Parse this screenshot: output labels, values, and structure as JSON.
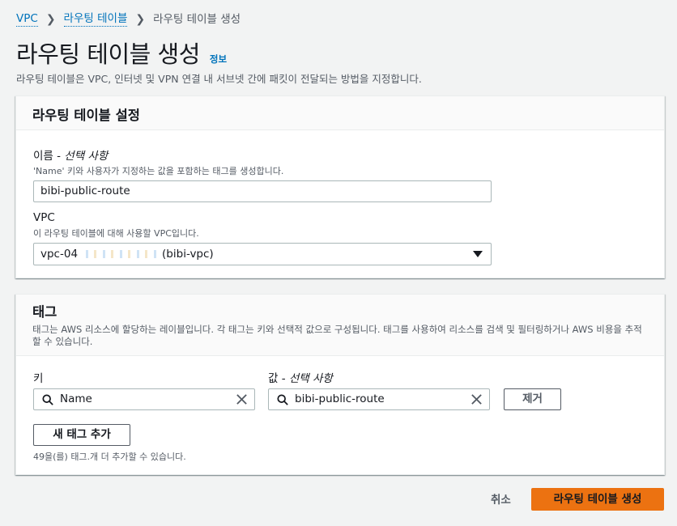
{
  "breadcrumb": {
    "items": [
      "VPC",
      "라우팅 테이블",
      "라우팅 테이블 생성"
    ]
  },
  "header": {
    "title": "라우팅 테이블 생성",
    "info_link": "정보",
    "description": "라우팅 테이블은 VPC, 인터넷 및 VPN 연결 내 서브넷 간에 패킷이 전달되는 방법을 지정합니다."
  },
  "settings_panel": {
    "title": "라우팅 테이블 설정",
    "name_label": "이름 - ",
    "name_label_optional": "선택 사항",
    "name_desc": "'Name' 키와 사용자가 지정하는 값을 포함하는 태그를 생성합니다.",
    "name_value": "bibi-public-route",
    "vpc_label": "VPC",
    "vpc_desc": "이 라우팅 테이블에 대해 사용할 VPC입니다.",
    "vpc_value_prefix": "vpc-04",
    "vpc_value_suffix": "(bibi-vpc)"
  },
  "tags_panel": {
    "title": "태그",
    "description": "태그는 AWS 리소스에 할당하는 레이블입니다. 각 태그는 키와 선택적 값으로 구성됩니다. 태그를 사용하여 리소스를 검색 및 필터링하거나 AWS 비용을 추적할 수 있습니다.",
    "key_label": "키",
    "value_label": "값 - ",
    "value_label_optional": "선택 사항",
    "key_value": "Name",
    "value_value": "bibi-public-route",
    "remove_label": "제거",
    "add_tag_label": "새 태그 추가",
    "remaining_text": "49을(를) 태그.개 더 추가할 수 있습니다."
  },
  "footer": {
    "cancel_label": "취소",
    "create_label": "라우팅 테이블 생성"
  },
  "colors": {
    "link": "#0073bb",
    "primary_button": "#ec7211",
    "page_background": "#f2f3f3"
  }
}
